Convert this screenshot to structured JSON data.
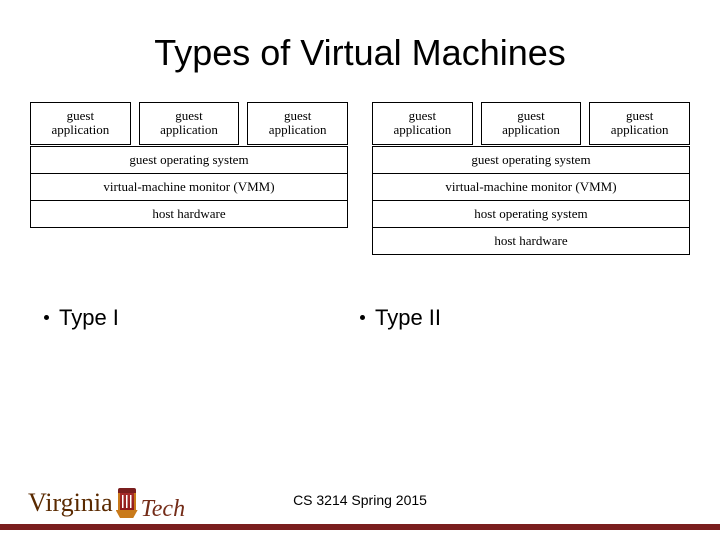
{
  "title": "Types of Virtual Machines",
  "type1": {
    "apps": [
      "guest\napplication",
      "guest\napplication",
      "guest\napplication"
    ],
    "layers": [
      "guest operating system",
      "virtual-machine monitor (VMM)",
      "host hardware"
    ]
  },
  "type2": {
    "apps": [
      "guest\napplication",
      "guest\napplication",
      "guest\napplication"
    ],
    "layers": [
      "guest operating system",
      "virtual-machine monitor (VMM)",
      "host operating system",
      "host hardware"
    ]
  },
  "labels": {
    "left": "Type I",
    "right": "Type II"
  },
  "footer": "CS 3214 Spring 2015",
  "logo": {
    "part1": "Virginia",
    "part2": "Tech"
  }
}
